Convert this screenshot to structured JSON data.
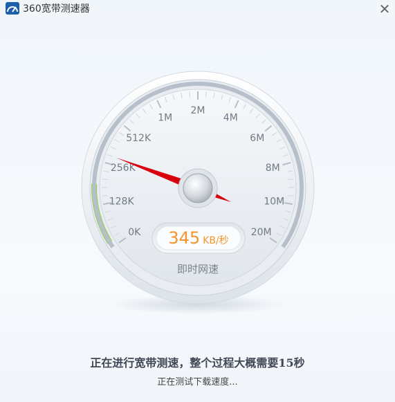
{
  "window": {
    "title": "360宽带测速器",
    "close_glyph": "✕"
  },
  "gauge": {
    "scale_labels": [
      "0K",
      "128K",
      "256K",
      "512K",
      "1M",
      "2M",
      "4M",
      "6M",
      "8M",
      "10M",
      "20M"
    ],
    "speed_value": "345",
    "speed_unit": "KB/秒",
    "caption": "即时网速"
  },
  "status": {
    "main": "正在进行宽带测速，整个过程大概需要15秒",
    "sub": "正在测试下载速度..."
  },
  "colors": {
    "needle": "#d9000d",
    "accent": "#f3952b",
    "progress": "#8fd34a"
  },
  "icons": {
    "logo": "360-speedometer-logo",
    "close": "close-icon"
  }
}
